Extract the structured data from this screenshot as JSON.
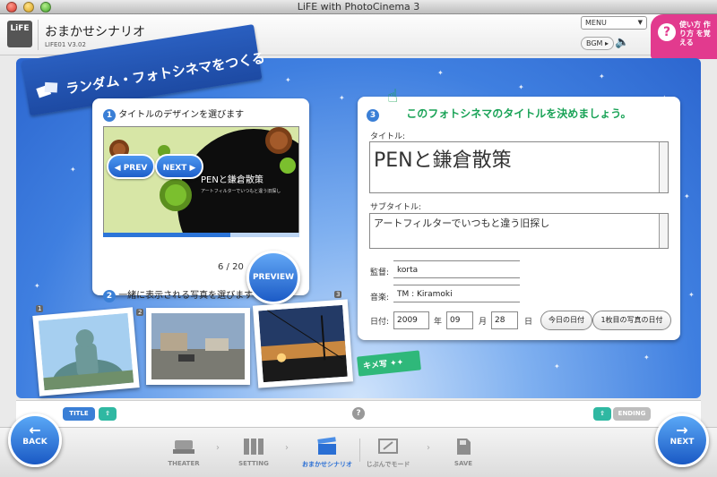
{
  "window": {
    "title": "LiFE with PhotoCinema 3"
  },
  "header": {
    "logo": "LiFE",
    "title": "おまかせシナリオ",
    "subtitle": "LIFE01 V3.02",
    "menu_label": "MENU",
    "bgm_label": "BGM",
    "help_text": "使い方 作り方 を覚える"
  },
  "banner": {
    "text": "ランダム・フォトシネマをつくる"
  },
  "left_panel": {
    "step1_num": "1",
    "step1_label": "タイトルのデザインを選びます",
    "preview_title": "PENと鎌倉散策",
    "preview_sub": "アートフィルターでいつもと違う旧探し",
    "preview_progress": 0.65,
    "prev_label": "◀ PREV",
    "next_label": "NEXT ▶",
    "counter": "6 / 20",
    "preview_button": "PREVIEW",
    "step2_num": "2",
    "step2_label": "一緒に表示される写真を選びます"
  },
  "photos": [
    {
      "num": "1"
    },
    {
      "num": "2"
    },
    {
      "num": "3"
    }
  ],
  "kimemoji_label": "キメ写",
  "right_panel": {
    "step_num": "3",
    "heading": "このフォトシネマのタイトルを決めましょう。",
    "title_label": "タイトル:",
    "title_value": "PENと鎌倉散策",
    "subtitle_label": "サブタイトル:",
    "subtitle_value": "アートフィルターでいつもと違う旧探し",
    "director_label": "監督:",
    "director_value": "korta",
    "music_label": "音楽:",
    "music_value": "TM : Kiramoki",
    "date_label": "日付:",
    "year": "2009",
    "year_unit": "年",
    "month": "09",
    "month_unit": "月",
    "day": "28",
    "day_unit": "日",
    "today_button": "今日の日付",
    "first_photo_button": "1枚目の写真の日付"
  },
  "strip": {
    "title_chip": "TITLE",
    "ending_chip": "ENDING",
    "help": "?"
  },
  "footer": {
    "back_label": "BACK",
    "next_label": "NEXT",
    "steps": [
      {
        "label": "THEATER",
        "icon": "theater-icon"
      },
      {
        "label": "SETTING",
        "icon": "setting-icon"
      },
      {
        "label": "おまかせシナリオ",
        "icon": "clapper-icon"
      },
      {
        "label": "じぶんでモード",
        "icon": "edit-mode-icon"
      },
      {
        "label": "SAVE",
        "icon": "save-icon"
      }
    ]
  },
  "colors": {
    "accent_blue": "#2b74d8",
    "heading_green": "#1aa357",
    "help_pink": "#e23a8e"
  }
}
